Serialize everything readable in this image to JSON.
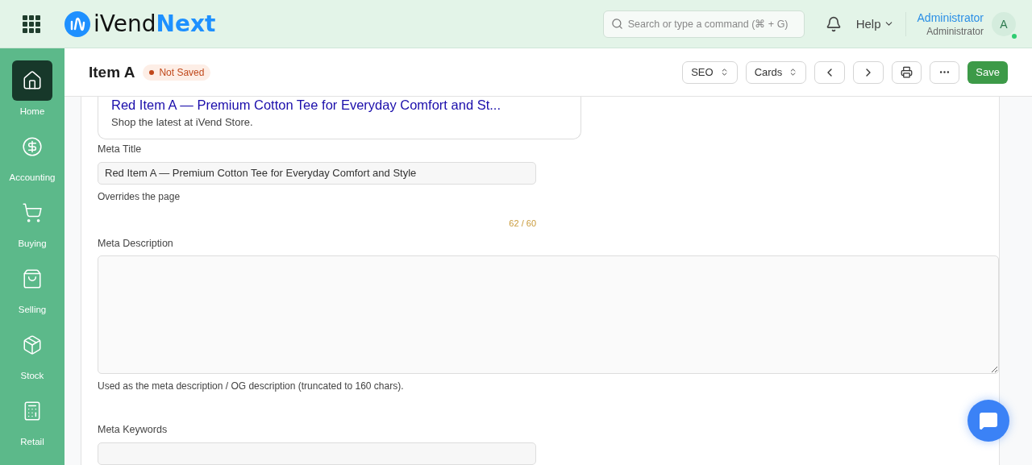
{
  "header": {
    "logo": {
      "word": "iVend",
      "accent": "Next"
    },
    "search": {
      "placeholder": "Search or type a command (⌘ + G)"
    },
    "help": "Help",
    "user": {
      "name": "Administrator",
      "role": "Administrator",
      "initial": "A",
      "online": true
    }
  },
  "sidebar": {
    "items": [
      {
        "label": "Home",
        "selected": true
      },
      {
        "label": "Accounting",
        "selected": false
      },
      {
        "label": "Buying",
        "selected": false
      },
      {
        "label": "Selling",
        "selected": false
      },
      {
        "label": "Stock",
        "selected": false
      },
      {
        "label": "Retail",
        "selected": false
      }
    ]
  },
  "titlebar": {
    "title": "Item A",
    "status": "Not Saved",
    "selects": [
      "SEO",
      "Cards"
    ],
    "save": "Save"
  },
  "preview": {
    "title": "Red Item A — Premium Cotton Tee for Everyday Comfort and St...",
    "description": "Shop the latest at iVend Store."
  },
  "fields": [
    {
      "kind": "input",
      "label": "Meta Title",
      "value": "Red Item A — Premium Cotton Tee for Everyday Comfort and Style",
      "help": "Overrides the page",
      "counter": "62 / 60"
    },
    {
      "kind": "textarea",
      "label": "Meta Description",
      "help": "Used as the meta description / OG description (truncated to 160 chars)."
    },
    {
      "kind": "input",
      "label": "Meta Keywords"
    }
  ]
}
